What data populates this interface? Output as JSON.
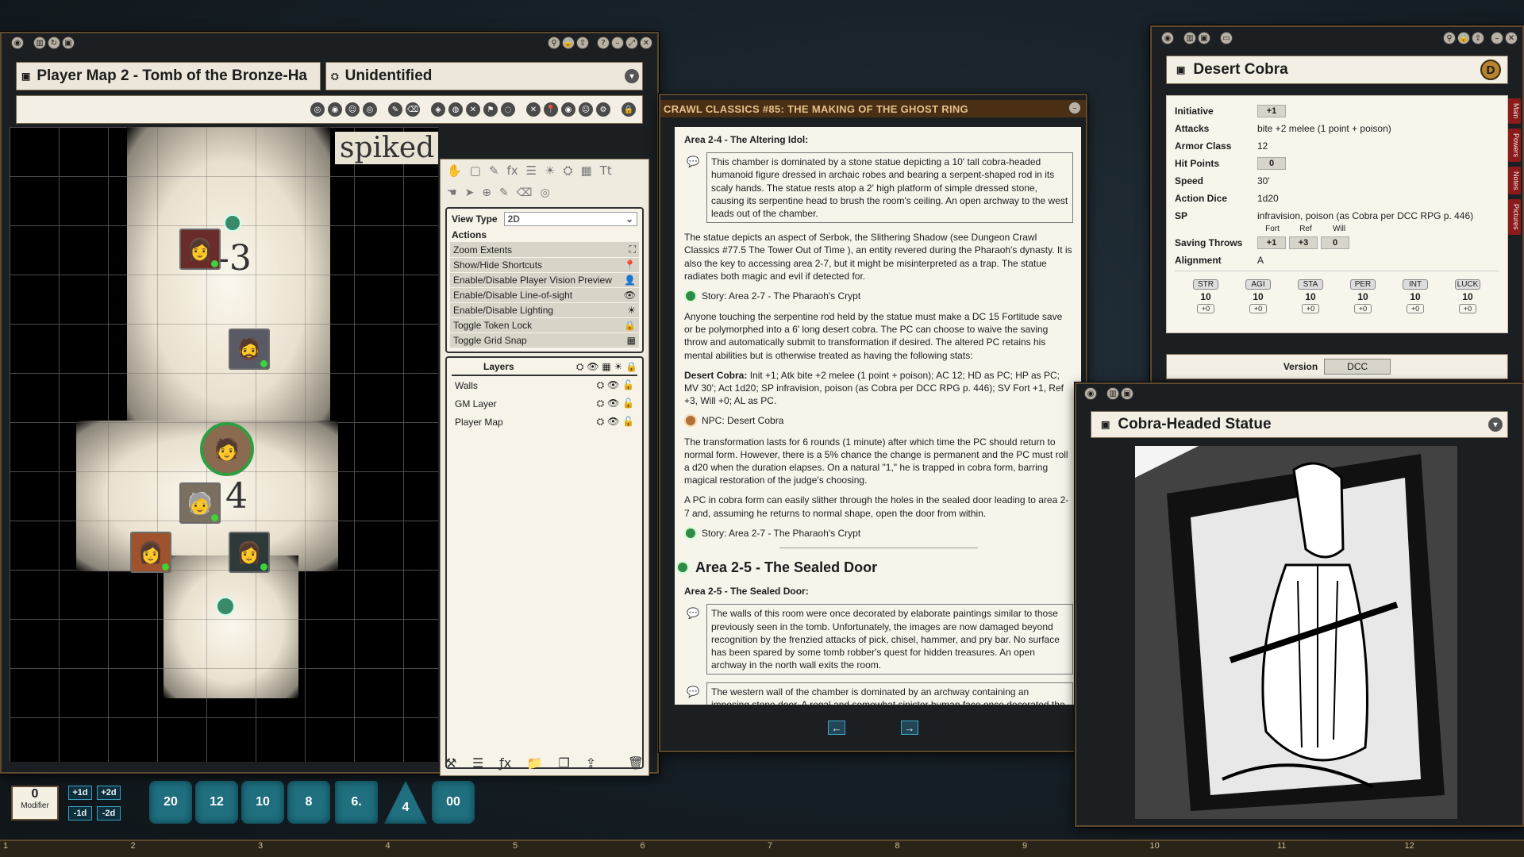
{
  "map_window": {
    "title": "Player Map 2 - Tomb of the Bronze-Ha",
    "subtitle": "Unidentified",
    "tool_tabs": [
      "✋",
      "▢",
      "✎",
      "fx",
      "☰",
      "☀",
      "⛭",
      "▦",
      "Tt"
    ],
    "view_type_label": "View Type",
    "view_type_value": "2D",
    "actions_label": "Actions",
    "actions": [
      {
        "label": "Zoom Extents",
        "icon": "⛶"
      },
      {
        "label": "Show/Hide Shortcuts",
        "icon": "📍"
      },
      {
        "label": "Enable/Disable Player Vision Preview",
        "icon": "👤"
      },
      {
        "label": "Enable/Disable Line-of-sight",
        "icon": "👁"
      },
      {
        "label": "Enable/Disable Lighting",
        "icon": "☀"
      },
      {
        "label": "Toggle Token Lock",
        "icon": "🔒"
      },
      {
        "label": "Toggle Grid Snap",
        "icon": "▦"
      }
    ],
    "layers_label": "Layers",
    "layers": [
      "Walls",
      "GM Layer",
      "Player Map"
    ],
    "map_text": {
      "num1": "-3",
      "num2": "4",
      "wall_text": "spiked"
    }
  },
  "story_window": {
    "header": "CRAWL CLASSICS #85: THE MAKING OF THE GHOST RING",
    "area24_heading": "Area 2-4 - The Altering Idol:",
    "boxed1": "This chamber is dominated by a stone statue depicting a 10' tall cobra-headed humanoid figure dressed in archaic robes and bearing a serpent-shaped rod in its scaly hands. The statue rests atop a 2' high platform of simple dressed stone, causing its serpentine head to brush the room's ceiling. An open archway to the west leads out of the chamber.",
    "para1": "The statue depicts an aspect of Serbok, the Slithering Shadow (see Dungeon Crawl Classics #77.5 The Tower Out of Time ), an entity revered during the Pharaoh's dynasty. It is also the key to accessing area 2-7, but it might be misinterpreted as a trap. The statue radiates both magic and evil if detected for.",
    "link1": "Story: Area 2-7 - The Pharaoh's Crypt",
    "para2": "Anyone touching the serpentine rod held by the statue must make a DC 15 Fortitude save or be polymorphed into a 6' long desert cobra. The PC can choose to waive the saving throw and automatically submit to transformation if desired. The altered PC retains his mental abilities but is otherwise treated as having the following stats:",
    "para3_bold": "Desert Cobra:",
    "para3": " Init +1; Atk bite +2 melee (1 point + poison); AC 12; HD as PC; HP as PC; MV 30'; Act 1d20; SP infravision, poison (as Cobra per DCC RPG p. 446); SV Fort +1, Ref +3, Will +0; AL as PC.",
    "npc_link": "NPC: Desert Cobra",
    "para4": "The transformation lasts for 6 rounds (1 minute) after which time the PC should return to normal form. However, there is a 5% chance the change is permanent and the PC must roll a d20 when the duration elapses. On a natural \"1,\" he is trapped in cobra form, barring magical restoration of the judge's choosing.",
    "para5": "A PC in cobra form can easily slither through the holes in the sealed door leading to area 2-7 and, assuming he returns to normal shape, open the door from within.",
    "link2": "Story: Area 2-7 - The Pharaoh's Crypt",
    "area25_title": "Area 2-5 - The Sealed Door",
    "area25_heading": "Area 2-5 - The Sealed Door:",
    "boxed2": "The walls of this room were once decorated by elaborate paintings similar to those previously seen in the tomb. Unfortunately, the images are now damaged beyond recognition by the frenzied attacks of pick, chisel, hammer, and pry bar. No surface has been spared by some tomb robber's quest for hidden treasures. An open archway in the north wall exits the room.",
    "boxed3": "The western wall of the chamber is dominated by an archway containing an imposing stone door. A regal and somewhat sinister human face once decorated the door, but it too"
  },
  "cobra_window": {
    "title": "Desert Cobra",
    "badge": "D",
    "initiative_label": "Initiative",
    "initiative": "+1",
    "attacks_label": "Attacks",
    "attacks": "bite +2 melee (1 point + poison)",
    "ac_label": "Armor Class",
    "ac": "12",
    "hp_label": "Hit Points",
    "hp": "0",
    "speed_label": "Speed",
    "speed": "30'",
    "dice_label": "Action Dice",
    "dice": "1d20",
    "sp_label": "SP",
    "sp": "infravision, poison (as Cobra per DCC RPG p. 446)",
    "saves_label": "Saving Throws",
    "save_heads": [
      "Fort",
      "Ref",
      "Will"
    ],
    "saves": [
      "+1",
      "+3",
      "0"
    ],
    "align_label": "Alignment",
    "align": "A",
    "stats": [
      {
        "name": "STR",
        "value": "10",
        "mod": "+0"
      },
      {
        "name": "AGI",
        "value": "10",
        "mod": "+0"
      },
      {
        "name": "STA",
        "value": "10",
        "mod": "+0"
      },
      {
        "name": "PER",
        "value": "10",
        "mod": "+0"
      },
      {
        "name": "INT",
        "value": "10",
        "mod": "+0"
      },
      {
        "name": "LUCK",
        "value": "10",
        "mod": "+0"
      }
    ],
    "version_label": "Version",
    "version": "DCC",
    "side_tabs": [
      "Main",
      "Powers",
      "Notes",
      "Pictures"
    ]
  },
  "statue_window": {
    "title": "Cobra-Headed Statue"
  },
  "dice_bar": {
    "modifier_value": "0",
    "modifier_label": "Modifier",
    "buttons": [
      "+1d",
      "+2d",
      "-1d",
      "-2d"
    ],
    "dice": [
      "20",
      "12",
      "10",
      "8",
      "6.",
      "4",
      "00"
    ]
  },
  "ruler": [
    "1",
    "2",
    "3",
    "4",
    "5",
    "6",
    "7",
    "8",
    "9",
    "10",
    "11",
    "12"
  ]
}
